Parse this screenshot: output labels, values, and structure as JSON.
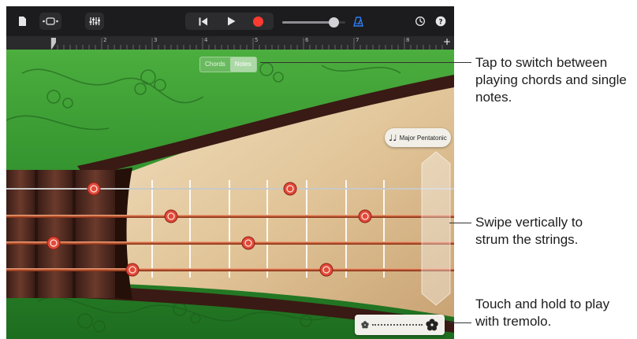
{
  "toolbar": {
    "icons": [
      "document-icon",
      "track-view-icon",
      "mixer-icon",
      "rewind-icon",
      "play-icon",
      "record-icon",
      "metronome-icon",
      "settings-icon",
      "help-icon"
    ],
    "volume_level": 0.82,
    "accent_color": "#2e7cf6",
    "record_color": "#ff3b30"
  },
  "ruler": {
    "numbers": [
      "1",
      "2",
      "3",
      "4",
      "5",
      "6",
      "7",
      "8"
    ],
    "add_label": "+"
  },
  "instrument": {
    "mode_toggle": {
      "options": [
        "Chords",
        "Notes"
      ],
      "selected": "Notes"
    },
    "scale_button": {
      "icon": "♩♩",
      "label": "Major Pentatonic"
    },
    "strings": 4,
    "frets": 7
  },
  "callouts": {
    "switch": "Tap to switch between playing chords and single notes.",
    "strum": "Swipe vertically to strum the strings.",
    "tremolo": "Touch and hold to play with tremolo."
  }
}
